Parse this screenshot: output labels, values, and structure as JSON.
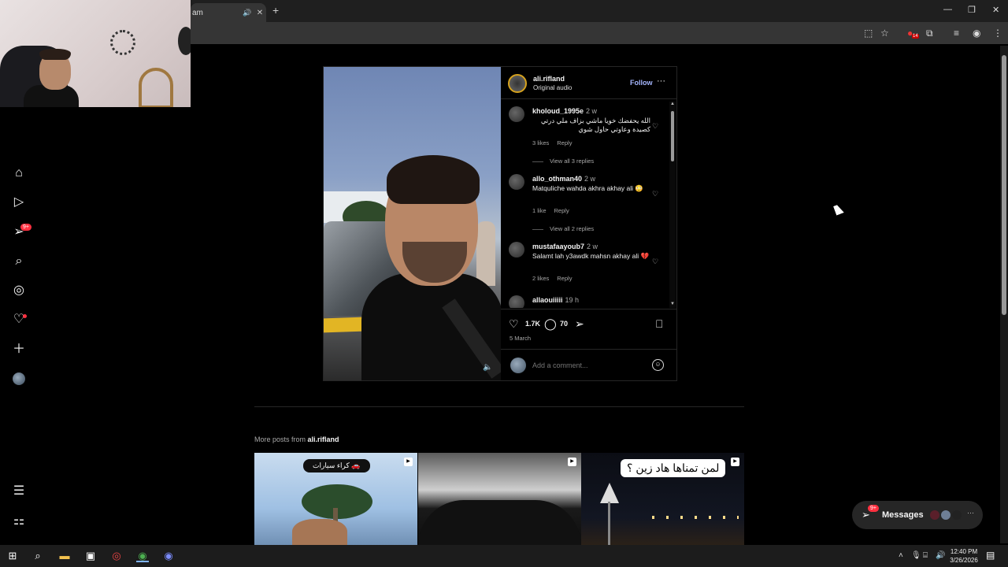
{
  "browser": {
    "tab_title": "am",
    "tab_audio_icon": "speaker-icon",
    "new_tab": "+",
    "window_controls": [
      "—",
      "❐",
      "✕"
    ]
  },
  "toolbar": {
    "extension_badge": "14"
  },
  "nav": {
    "notifications_badge": "9+"
  },
  "post": {
    "username": "ali.rifland",
    "audio": "Original audio",
    "follow": "Follow",
    "likes": "1.7K",
    "comments_count": "70",
    "date": "5 March",
    "add_comment_placeholder": "Add a comment..."
  },
  "comments": [
    {
      "user": "kholoud_1995e",
      "time": "2 w",
      "text": "الله يحفضك خويا ماشي بزاف ملي درتي كصيدة وعاوتي حاول شوي",
      "rtl": true,
      "likes": "3 likes",
      "reply": "Reply",
      "view_replies": "View all 3 replies"
    },
    {
      "user": "allo_othman40",
      "time": "2 w",
      "text": "Matquliche wahda akhra akhay ali 😳",
      "rtl": false,
      "likes": "1 like",
      "reply": "Reply",
      "view_replies": "View all 2 replies"
    },
    {
      "user": "mustafaayoub7",
      "time": "2 w",
      "text": "Salamt lah y3awdk mahsn akhay ali 💔",
      "rtl": false,
      "likes": "2 likes",
      "reply": "Reply",
      "view_replies": ""
    },
    {
      "user": "allaouiiiii",
      "time": "19 h",
      "text": "",
      "rtl": false,
      "likes": "",
      "reply": "",
      "view_replies": ""
    }
  ],
  "more_posts": {
    "prefix": "More posts from",
    "user": "ali.rifland",
    "thumb1_tag": "كراء سيارات 🚗",
    "thumb3_question": "لمن تمناها هاد زين ؟"
  },
  "messages": {
    "label": "Messages",
    "badge": "9+"
  },
  "taskbar": {
    "time": "12:40 PM",
    "date": "3/26/2026"
  },
  "colors": {
    "accent_follow": "#a6b7ff",
    "badge_red": "#ff3040",
    "background": "#000000"
  }
}
